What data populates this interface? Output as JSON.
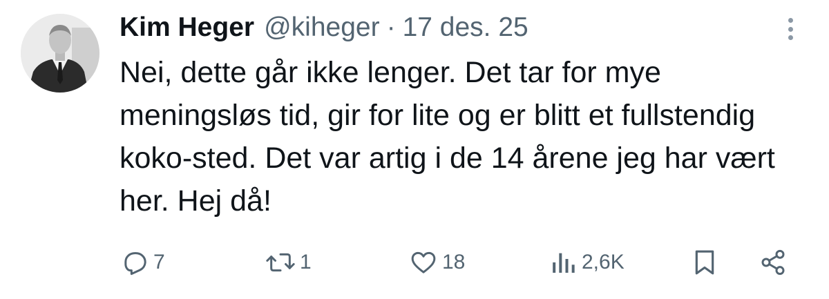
{
  "tweet": {
    "author_name": "Kim Heger",
    "handle": "@kiheger",
    "separator": "·",
    "date": "17 des. 25",
    "text": "Nei, dette går ikke lenger. Det tar for mye meningsløs tid, gir for lite og er blitt et fullstendig koko-sted. Det var artig i de 14 årene jeg har vært her. Hej då!"
  },
  "actions": {
    "reply": {
      "icon": "reply-icon",
      "count": "7"
    },
    "retweet": {
      "icon": "retweet-icon",
      "count": "1"
    },
    "like": {
      "icon": "heart-icon",
      "count": "18"
    },
    "views": {
      "icon": "views-icon",
      "count": "2,6K"
    },
    "bookmark": {
      "icon": "bookmark-icon"
    },
    "share": {
      "icon": "share-icon"
    }
  },
  "colors": {
    "text_primary": "#0f1419",
    "text_secondary": "#536471"
  }
}
